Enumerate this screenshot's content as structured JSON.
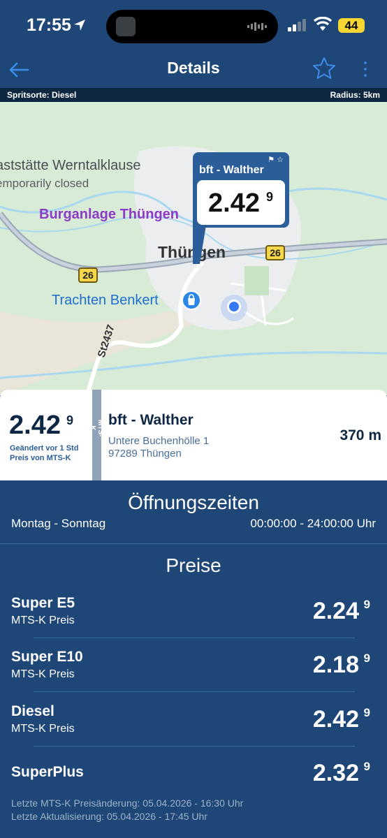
{
  "status": {
    "time": "17:55",
    "battery": "44"
  },
  "nav": {
    "title": "Details"
  },
  "filter": {
    "fuel_type": "Spritsorte: Diesel",
    "radius": "Radius: 5km"
  },
  "map": {
    "label_raststaette": "aststätte Werntalklause",
    "label_temp_closed": "emporarily closed",
    "label_burg": "Burganlage Thüngen",
    "label_town": "Thüngen",
    "label_trachten": "Trachten Benkert",
    "label_st": "St2437",
    "shield_26": "26",
    "callout": {
      "name": "bft - Walther",
      "price": "2.42",
      "price_sup": "9"
    }
  },
  "station": {
    "price": "2.42",
    "price_sup": "9",
    "changed": "Geändert vor 1 Std",
    "source": "Preis von MTS-K",
    "vertical_label": "MTS-K",
    "name": "bft - Walther",
    "street": "Untere Buchenhölle 1",
    "city": "97289 Thüngen",
    "distance": "370 m"
  },
  "opening": {
    "title": "Öffnungszeiten",
    "days": "Montag - Sonntag",
    "hours": "00:00:00 - 24:00:00 Uhr"
  },
  "prices": {
    "title": "Preise",
    "items": [
      {
        "name": "Super E5",
        "source": "MTS-K Preis",
        "price": "2.24",
        "sup": "9"
      },
      {
        "name": "Super E10",
        "source": "MTS-K Preis",
        "price": "2.18",
        "sup": "9"
      },
      {
        "name": "Diesel",
        "source": "MTS-K Preis",
        "price": "2.42",
        "sup": "9"
      },
      {
        "name": "SuperPlus",
        "source": "",
        "price": "2.32",
        "sup": "9"
      }
    ]
  },
  "footer": {
    "last_change": "Letzte MTS-K Preisänderung: 05.04.2026 - 16:30 Uhr",
    "last_update": "Letzte Aktualisierung: 05.04.2026 - 17:45 Uhr"
  },
  "colors": {
    "header": "#1e4677",
    "accent": "#2b5e99",
    "card_text": "#0d2745"
  }
}
